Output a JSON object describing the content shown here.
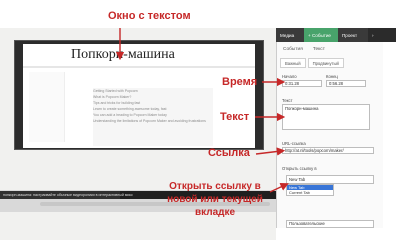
{
  "annotations": {
    "text_window": "Окно с текстом",
    "time": "Время",
    "text": "Текст",
    "link": "Ссылка",
    "open_link": "Открыть ссылку в новой или текущей вкладке"
  },
  "preview": {
    "popcorn_title": "Попкорн-машина",
    "list_items": [
      "Getting Started with Popcorn",
      "What is Popcorn Maker?",
      "Tips and tricks for building fast",
      "Learn to create something awesome today, fast",
      "You can add a heading to Popcorn Maker today",
      "Understanding the limitations of Popcorn Maker and avoiding frustrations"
    ]
  },
  "timeline": {
    "track_text": "попкорн-машина: настраивайте обычные видеоролики в интерактивный микс"
  },
  "sidebar": {
    "top": {
      "media": "Медиа",
      "events": "+ Событие",
      "project": "Проект",
      "more_arrow": "›"
    },
    "tabs": [
      "События",
      "Текст"
    ],
    "subtabs": [
      "Важный",
      "Продвинутый"
    ],
    "start_label": "Начало",
    "start_value": "0:31.28",
    "end_label": "Конец",
    "end_value": "0:56.28",
    "text_label": "Текст",
    "text_value": "Попкорн-машина",
    "url_label": "URL-ссылка",
    "url_value": "http://at.nl/tools/popcorn/maker/",
    "open_label": "Открыть ссылку в",
    "open_selected": "New Tab",
    "options": [
      "New Tab",
      "Current Tab"
    ],
    "bottom_select": "Пользовательские"
  }
}
